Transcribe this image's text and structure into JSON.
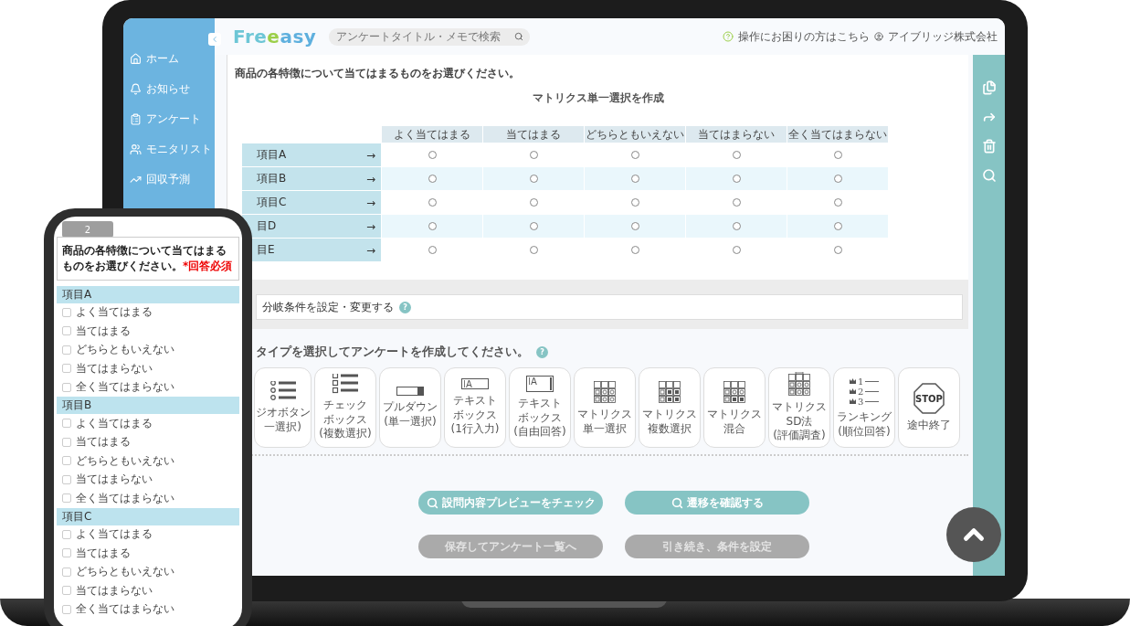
{
  "laptop": {
    "sidebar": {
      "items": [
        {
          "label": "ホーム"
        },
        {
          "label": "お知らせ"
        },
        {
          "label": "アンケート"
        },
        {
          "label": "モニタリスト"
        },
        {
          "label": "回収予測"
        }
      ]
    },
    "header": {
      "logo": [
        "Fre",
        "e",
        "asy"
      ],
      "search": {
        "placeholder": "アンケートタイトル・メモで検索"
      },
      "help": "操作にお困りの方はこちら",
      "company": "アイブリッジ株式会社"
    },
    "question": "商品の各特徴について当てはまるものをお選びください。",
    "matrix": {
      "title": "マトリクス単一選択を作成",
      "columns": [
        "よく当てはまる",
        "当てはまる",
        "どちらともいえない",
        "当てはまらない",
        "全く当てはまらない"
      ],
      "rows": [
        {
          "label": "項目A",
          "arrow": "→",
          "selected": [
            false,
            false,
            false,
            false,
            false
          ]
        },
        {
          "label": "項目B",
          "arrow": "→",
          "selected": [
            false,
            false,
            false,
            false,
            false
          ]
        },
        {
          "label": "項目C",
          "arrow": "→",
          "selected": [
            false,
            false,
            false,
            false,
            false
          ]
        },
        {
          "label": "目D",
          "arrow": "→",
          "selected": [
            false,
            false,
            false,
            false,
            false
          ]
        },
        {
          "label": "目E",
          "arrow": "→",
          "selected": [
            false,
            false,
            false,
            false,
            false
          ]
        }
      ]
    },
    "branch": {
      "label": "分岐条件を設定・変更する",
      "help": "?"
    },
    "types_heading": {
      "label": "タイプを選択してアンケートを作成してください。",
      "help": "?"
    },
    "types": [
      {
        "kind": "radio",
        "lines": [
          "ジオボタン",
          "一選択)"
        ]
      },
      {
        "kind": "checkbox",
        "lines": [
          "チェック",
          "ボックス",
          "(複数選択)"
        ]
      },
      {
        "kind": "dropdown",
        "lines": [
          "プルダウン",
          "(単一選択)"
        ]
      },
      {
        "kind": "textline",
        "icon_text": "A",
        "lines": [
          "テキスト",
          "ボックス",
          "(1行入力)"
        ]
      },
      {
        "kind": "textarea",
        "icon_text": "A",
        "lines": [
          "テキスト",
          "ボックス",
          "(自由回答)"
        ]
      },
      {
        "kind": "matrix",
        "lines": [
          "マトリクス",
          "単一選択"
        ]
      },
      {
        "kind": "matrix-multi",
        "lines": [
          "マトリクス",
          "複数選択"
        ]
      },
      {
        "kind": "matrix-mixed",
        "lines": [
          "マトリクス",
          "混合"
        ]
      },
      {
        "kind": "matrix-sd",
        "lines": [
          "マトリクス",
          "SD法",
          "(評価調査)"
        ]
      },
      {
        "kind": "ranking",
        "icon_text": [
          "1",
          "2",
          "3"
        ],
        "lines": [
          "ランキング",
          "(順位回答)"
        ]
      },
      {
        "kind": "stop",
        "icon_text": "STOP",
        "lines": [
          "途中終了"
        ]
      }
    ],
    "buttons": [
      {
        "label": "設問内容プレビューをチェック",
        "kind": "search",
        "disabled": false
      },
      {
        "label": "遷移を確認する",
        "kind": "search",
        "disabled": false
      },
      {
        "label": "保存してアンケート一覧へ",
        "kind": "plain",
        "disabled": true
      },
      {
        "label": "引き続き、条件を設定",
        "kind": "plain",
        "disabled": true
      }
    ]
  },
  "phone": {
    "number": "2",
    "question": "商品の各特徴について当てはまるものをお選びください。",
    "required": "*回答必須",
    "sections": [
      {
        "label": "項目A",
        "options": [
          {
            "label": "よく当てはまる",
            "checked": false
          },
          {
            "label": "当てはまる",
            "checked": false
          },
          {
            "label": "どちらともいえない",
            "checked": false
          },
          {
            "label": "当てはまらない",
            "checked": false
          },
          {
            "label": "全く当てはまらない",
            "checked": false
          }
        ]
      },
      {
        "label": "項目B",
        "options": [
          {
            "label": "よく当てはまる",
            "checked": false
          },
          {
            "label": "当てはまる",
            "checked": false
          },
          {
            "label": "どちらともいえない",
            "checked": false
          },
          {
            "label": "当てはまらない",
            "checked": false
          },
          {
            "label": "全く当てはまらない",
            "checked": false
          }
        ]
      },
      {
        "label": "項目C",
        "options": [
          {
            "label": "よく当てはまる",
            "checked": false
          },
          {
            "label": "当てはまる",
            "checked": false
          },
          {
            "label": "どちらともいえない",
            "checked": false
          },
          {
            "label": "当てはまらない",
            "checked": false
          },
          {
            "label": "全く当てはまらない",
            "checked": false
          }
        ]
      }
    ]
  }
}
